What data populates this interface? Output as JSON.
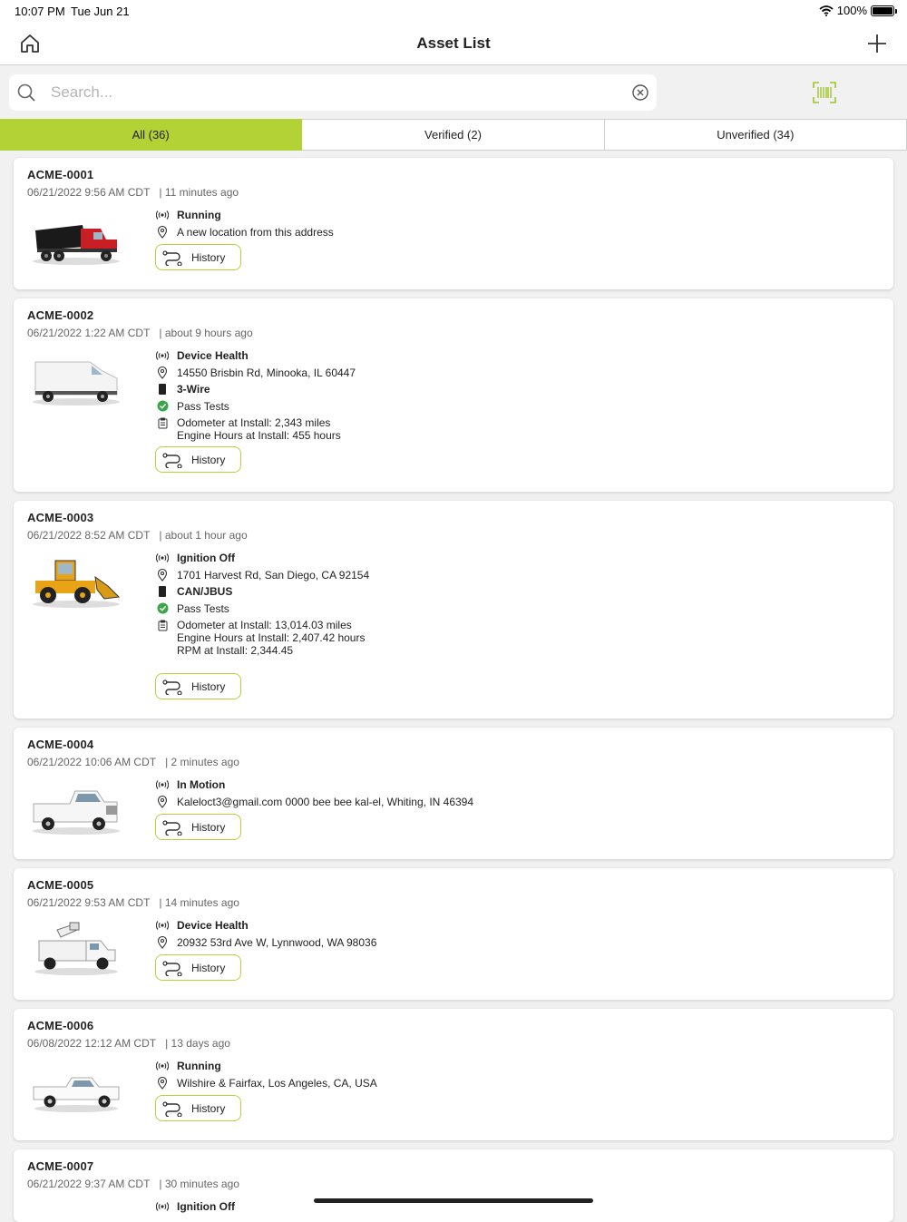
{
  "status_bar": {
    "time": "10:07 PM",
    "date": "Tue Jun 21",
    "battery": "100%"
  },
  "header": {
    "title": "Asset List"
  },
  "search": {
    "placeholder": "Search..."
  },
  "tabs": [
    {
      "label": "All (36)",
      "active": true
    },
    {
      "label": "Verified (2)",
      "active": false
    },
    {
      "label": "Unverified (34)",
      "active": false
    }
  ],
  "colors": {
    "accent": "#b3d236",
    "pass": "#3aa64a",
    "barcode": "#9ec62a"
  },
  "history_label": "History",
  "assets": [
    {
      "id": "ACME-0001",
      "timestamp": "06/21/2022 9:56 AM CDT",
      "ago": "| 11 minutes ago",
      "image": "dump-truck",
      "status": "Running",
      "location": "A new location from this address"
    },
    {
      "id": "ACME-0002",
      "timestamp": "06/21/2022 1:22 AM CDT",
      "ago": "| about 9 hours ago",
      "image": "cargo-van",
      "status": "Device Health",
      "location": "14550 Brisbin Rd, Minooka, IL 60447",
      "wiring": "3-Wire",
      "tests": "Pass Tests",
      "odometer_lines": [
        "Odometer at Install: 2,343  miles",
        "Engine Hours at Install: 455 hours"
      ]
    },
    {
      "id": "ACME-0003",
      "timestamp": "06/21/2022 8:52 AM CDT",
      "ago": "| about 1 hour ago",
      "image": "wheel-loader",
      "status": "Ignition Off",
      "location": "1701 Harvest Rd, San Diego, CA 92154",
      "wiring": "CAN/JBUS",
      "tests": "Pass Tests",
      "odometer_lines": [
        "Odometer at Install: 13,014.03  miles",
        "Engine Hours at Install: 2,407.42 hours",
        "RPM at Install: 2,344.45"
      ]
    },
    {
      "id": "ACME-0004",
      "timestamp": "06/21/2022 10:06 AM CDT",
      "ago": "| 2 minutes ago",
      "image": "pickup-truck",
      "status": "In Motion",
      "location": "Kaleloct3@gmail.com 0000 bee bee kal-el, Whiting, IN 46394"
    },
    {
      "id": "ACME-0005",
      "timestamp": "06/21/2022 9:53 AM CDT",
      "ago": "| 14 minutes ago",
      "image": "bucket-truck",
      "status": "Device Health",
      "location": "20932 53rd Ave W, Lynnwood, WA 98036"
    },
    {
      "id": "ACME-0006",
      "timestamp": "06/08/2022 12:12 AM CDT",
      "ago": "| 13 days ago",
      "image": "white-pickup",
      "status": "Running",
      "location": "Wilshire & Fairfax, Los Angeles, CA, USA"
    },
    {
      "id": "ACME-0007",
      "timestamp": "06/21/2022 9:37 AM CDT",
      "ago": "| 30 minutes ago",
      "image": "vehicle",
      "status": "Ignition Off"
    }
  ]
}
